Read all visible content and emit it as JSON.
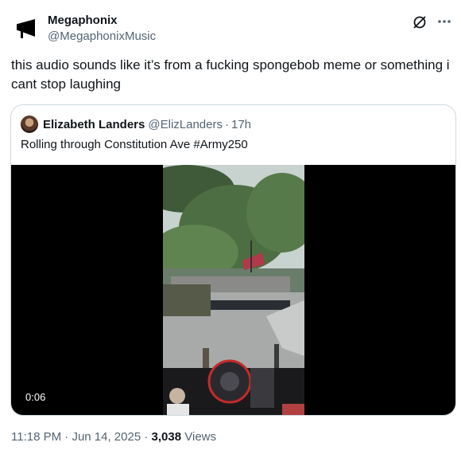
{
  "author": {
    "display_name": "Megaphonix",
    "handle": "@MegaphonixMusic"
  },
  "tweet": {
    "text": "this audio sounds like it’s from a fucking spongebob meme or something i cant stop laughing"
  },
  "quote": {
    "display_name": "Elizabeth Landers",
    "handle": "@ElizLanders",
    "separator": "·",
    "time": "17h",
    "text": "Rolling through Constitution Ave #Army250",
    "video": {
      "duration": "0:06"
    }
  },
  "meta": {
    "time": "11:18 PM",
    "separator1": "·",
    "date": "Jun 14, 2025",
    "separator2": "·",
    "views_count": "3,038",
    "views_label": "Views"
  },
  "icons": {
    "avatar": "megaphone-icon",
    "grok": "grok-icon",
    "more": "more-icon"
  }
}
